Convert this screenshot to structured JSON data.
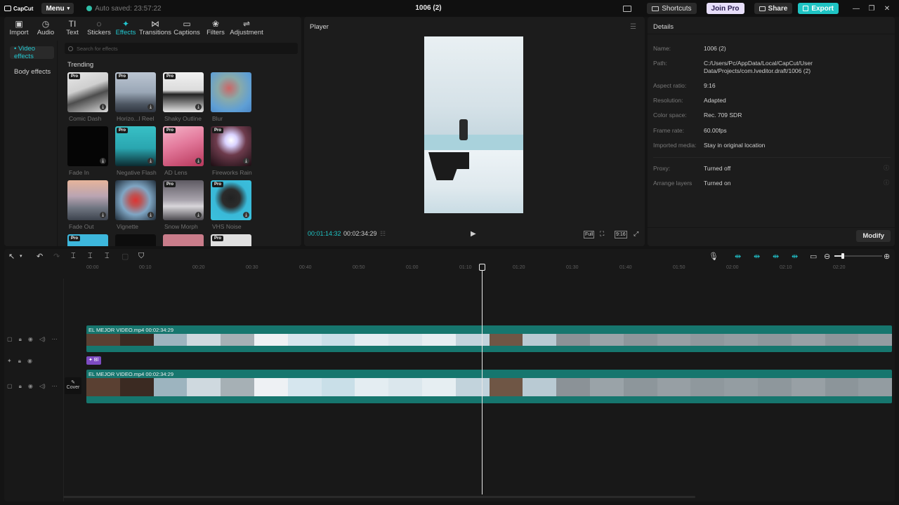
{
  "titlebar": {
    "logo": "CapCut",
    "menu": "Menu",
    "autosave": "Auto saved: 23:57:22",
    "project_title": "1006 (2)",
    "shortcuts": "Shortcuts",
    "join_pro": "Join Pro",
    "share": "Share",
    "export": "Export"
  },
  "toolbar": {
    "import": "Import",
    "audio": "Audio",
    "text": "Text",
    "stickers": "Stickers",
    "effects": "Effects",
    "transitions": "Transitions",
    "captions": "Captions",
    "filters": "Filters",
    "adjustment": "Adjustment"
  },
  "effects_nav": {
    "video_effects": "• Video effects",
    "body_effects": "Body effects"
  },
  "search_placeholder": "Search for effects",
  "trending": "Trending",
  "pro_badge": "Pro",
  "effects": [
    {
      "label": "Comic Dash",
      "pro": true
    },
    {
      "label": "Horizo...l Reel",
      "pro": true
    },
    {
      "label": "Shaky Outline",
      "pro": true
    },
    {
      "label": "Blur",
      "pro": false
    },
    {
      "label": "Fade In",
      "pro": false
    },
    {
      "label": "Negative Flash",
      "pro": true
    },
    {
      "label": "AD Lens",
      "pro": true
    },
    {
      "label": "Fireworks Rain",
      "pro": true
    },
    {
      "label": "Fade Out",
      "pro": false
    },
    {
      "label": "Vignette",
      "pro": false
    },
    {
      "label": "Snow Morph",
      "pro": true
    },
    {
      "label": "VHS Noise",
      "pro": true
    }
  ],
  "player": {
    "title": "Player",
    "current_time": "00:01:14:32",
    "total_time": "00:02:34:29",
    "full": "Full",
    "ratio": "9:16"
  },
  "details": {
    "title": "Details",
    "rows": [
      {
        "key": "Name:",
        "value": "1006 (2)"
      },
      {
        "key": "Path:",
        "value": "C:/Users/Pc/AppData/Local/CapCut/User Data/Projects/com.lveditor.draft/1006 (2)"
      },
      {
        "key": "Aspect ratio:",
        "value": "9:16"
      },
      {
        "key": "Resolution:",
        "value": "Adapted"
      },
      {
        "key": "Color space:",
        "value": "Rec. 709 SDR"
      },
      {
        "key": "Frame rate:",
        "value": "60.00fps"
      },
      {
        "key": "Imported media:",
        "value": "Stay in original location"
      },
      {
        "key": "Proxy:",
        "value": "Turned off"
      },
      {
        "key": "Arrange layers",
        "value": "Turned on"
      }
    ],
    "modify": "Modify"
  },
  "timeline": {
    "ruler": [
      "00:00",
      "00:10",
      "00:20",
      "00:30",
      "00:40",
      "00:50",
      "01:00",
      "01:10",
      "01:20",
      "01:30",
      "01:40",
      "01:50",
      "02:00",
      "02:10",
      "02:20"
    ],
    "clip_top_label": "EL MEJOR VIDEO.mp4   00:02:34:29",
    "effect_clip_label": "Bl",
    "clip_main_label": "EL MEJOR VIDEO.mp4   00:02:34:29",
    "cover": "Cover"
  }
}
